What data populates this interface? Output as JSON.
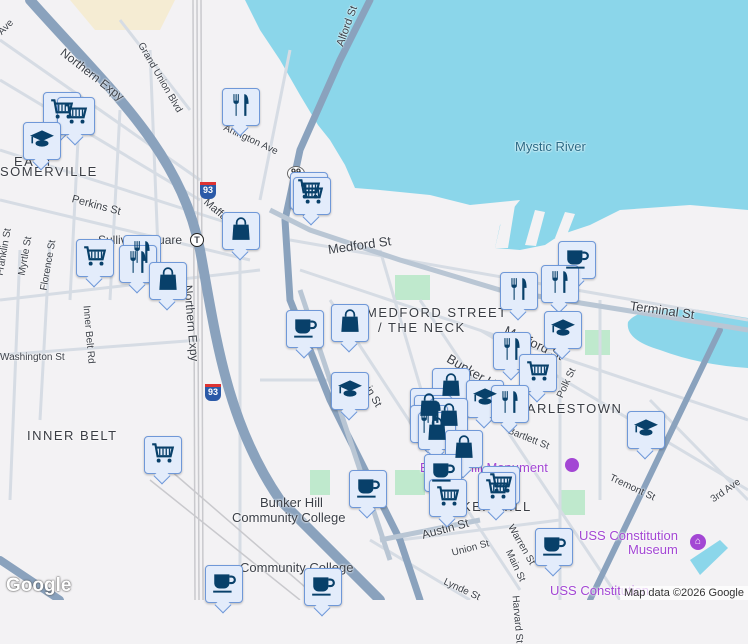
{
  "map": {
    "labels": {
      "mystic_river": "Mystic River",
      "medford_st": "Medford St",
      "medford_st2": "Medford St",
      "terminal_st": "Terminal St",
      "neck_line1": "MEDFORD STREET",
      "neck_line2": "/ THE NECK",
      "bunker_hill_st": "Bunker Hill St",
      "charlestown": "CHARLESTOWN",
      "inner_belt": "INNER BELT",
      "east_somerville_1": "EAST",
      "east_somerville_2": "SOMERVILLE",
      "northern_expy": "Northern Expy",
      "northern_expy2": "Northern Expy",
      "grand_union": "Grand Union Blvd",
      "arlington_ave": "Arlington Ave",
      "alford_st": "Alford St",
      "perkins_st": "Perkins St",
      "sullivan_square": "Sullivan Square",
      "maffa": "Maffa Way",
      "franklin_st": "Franklin St",
      "myrtle_st": "Myrtle St",
      "florence_st": "Florence St",
      "inner_belt_rd": "Inner Belt Rd",
      "washington_st": "Washington St",
      "main_st": "Main St",
      "main_st2": "Main St",
      "bhcc_1": "Bunker Hill",
      "bhcc_2": "Community College",
      "community_college": "Community College",
      "austin_st": "Austin St",
      "union_st": "Union St",
      "lynde_st": "Lynde St",
      "warren_st": "Warren St",
      "harvard_st": "Harvard St",
      "tremont_st": "Tremont St",
      "third_ave": "3rd Ave",
      "polk_st": "Polk St",
      "bartlett_st": "Bartlett St",
      "bunker_hill_monument": "Bunker Hill Monument",
      "bunker_hill_area": "BUNKER HILL",
      "uss_museum_1": "USS Constitution",
      "uss_museum_2": "Museum",
      "uss_constitution": "USS Constitution",
      "ave": "Ave",
      "st_label": "St",
      "chelsea_st": "St",
      "union_st_left": "Union St"
    },
    "shields": {
      "i93": "93",
      "i93b": "93",
      "r99": "99"
    },
    "attribution": "Map data ©2026 Google",
    "logo": "Google",
    "colors": {
      "water": "#8bd6ea",
      "highway": "#8aa2bd",
      "road": "#d6dce4",
      "land": "#f3f2f4",
      "park": "#bfe9cd",
      "marker_bg": "#e3ecfb",
      "marker_border": "#6f98d8",
      "icon": "#08406a",
      "poi": "#a347d4"
    },
    "markers": [
      {
        "type": "shopping-cart"
      },
      {
        "type": "shopping-cart"
      },
      {
        "type": "school"
      },
      {
        "type": "restaurant"
      },
      {
        "type": "shopping-cart"
      },
      {
        "type": "shopping-cart"
      },
      {
        "type": "shopping-bag"
      },
      {
        "type": "shopping-cart"
      },
      {
        "type": "restaurant"
      },
      {
        "type": "restaurant"
      },
      {
        "type": "shopping-bag"
      },
      {
        "type": "coffee"
      },
      {
        "type": "shopping-bag"
      },
      {
        "type": "school"
      },
      {
        "type": "shopping-cart"
      },
      {
        "type": "coffee"
      },
      {
        "type": "coffee"
      },
      {
        "type": "coffee"
      },
      {
        "type": "coffee"
      },
      {
        "type": "restaurant"
      },
      {
        "type": "restaurant"
      },
      {
        "type": "school"
      },
      {
        "type": "restaurant"
      },
      {
        "type": "shopping-cart"
      },
      {
        "type": "shopping-bag"
      },
      {
        "type": "school"
      },
      {
        "type": "restaurant"
      },
      {
        "type": "shopping-bag"
      },
      {
        "type": "restaurant"
      },
      {
        "type": "shopping-bag"
      },
      {
        "type": "restaurant"
      },
      {
        "type": "shopping-bag"
      },
      {
        "type": "school"
      },
      {
        "type": "shopping-bag"
      },
      {
        "type": "coffee"
      },
      {
        "type": "shopping-cart"
      },
      {
        "type": "shopping-cart"
      },
      {
        "type": "shopping-cart"
      },
      {
        "type": "coffee"
      }
    ]
  }
}
